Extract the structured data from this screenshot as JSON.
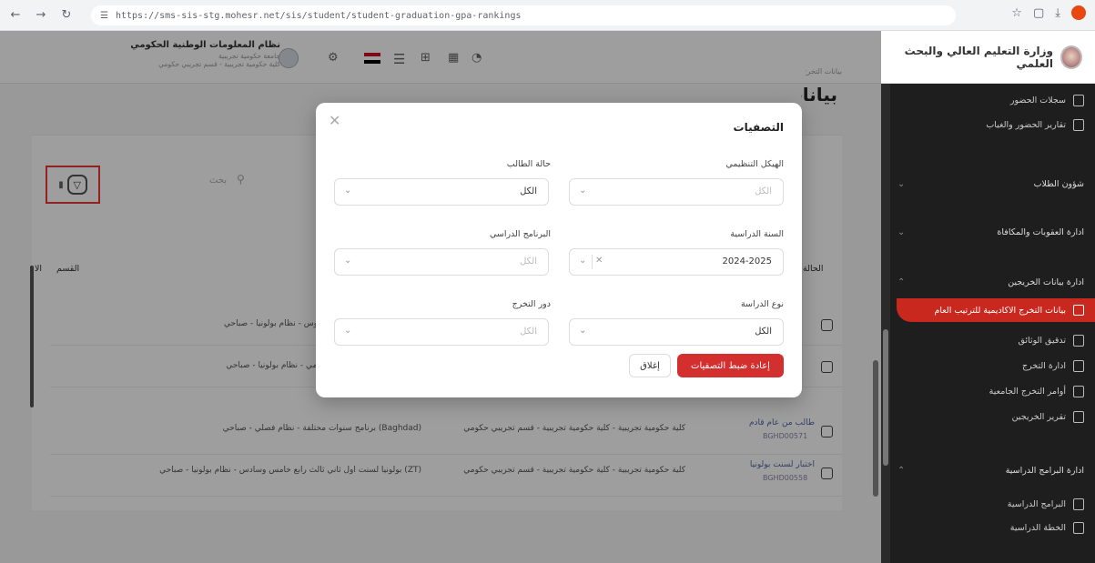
{
  "browser": {
    "url": "https://sms-sis-stg.mohesr.net/sis/student/student-graduation-gpa-rankings",
    "back_icon": "arrow-left-icon",
    "forward_icon": "arrow-right-icon",
    "reload_icon": "reload-icon"
  },
  "sidebar": {
    "ministry_name": "وزارة التعليم العالي والبحث العلمي",
    "items": [
      {
        "label": "سجلات الحضور",
        "type": "item"
      },
      {
        "label": "تقارير الحضور والغياب",
        "type": "item"
      },
      {
        "label": "شؤون الطلاب",
        "type": "group"
      },
      {
        "label": "ادارة العقوبات والمكافاة",
        "type": "group"
      },
      {
        "label": "ادارة بيانات الخريجين",
        "type": "group"
      },
      {
        "label": "بيانات التخرج الاكاديمية للترتيب العام",
        "type": "active"
      },
      {
        "label": "تدقيق الوثائق",
        "type": "item"
      },
      {
        "label": "ادارة التخرج",
        "type": "item"
      },
      {
        "label": "أوامر التخرج الجامعية",
        "type": "item"
      },
      {
        "label": "تقرير الخريجين",
        "type": "item"
      },
      {
        "label": "ادارة البرامج الدراسية",
        "type": "group"
      },
      {
        "label": "البرامج الدراسية",
        "type": "item"
      },
      {
        "label": "الخطة الدراسية",
        "type": "item"
      }
    ]
  },
  "topbar": {
    "uni_name": "نظام المعلومات الوطنية الحكومي",
    "uni_sub1": "جامعة حكومية تجريبية",
    "uni_sub2": "كلية حكومية تجريبية - قسم تجريبي حكومي"
  },
  "page": {
    "breadcrumb": "بيانات التخرج",
    "title": "بيانات",
    "search_placeholder": "بحث",
    "col_section": "القسم",
    "col_index": "الا",
    "col_status": "الحالة",
    "rows": [
      {
        "name": "",
        "id": "",
        "dept": "",
        "program": "برنامج بكالوريوس - نظام بولونيا - صباحي"
      },
      {
        "name": "",
        "id": "",
        "dept": "",
        "program": "بكالوريوس علمي - نظام بولونيا - صباحي"
      },
      {
        "name": "طالب من عام قادم",
        "id": "BGHD00571",
        "dept": "كلية حكومية تجريبية - كلية حكومية تجريبية - قسم تجريبي حكومي",
        "program": "(Baghdad) برنامج سنوات محتلفة - نظام فصلي - صباحي"
      },
      {
        "name": "اختبار لسنت بولونيا",
        "id": "BGHD00558",
        "dept": "كلية حكومية تجريبية - كلية حكومية تجريبية - قسم تجريبي حكومي",
        "program": "(ZT) بولونيا لسنت اول ثاني ثالث رابع خامس وسادس - نظام بولونيا - صباحي"
      }
    ]
  },
  "modal": {
    "title": "التصفيات",
    "close_icon": "close-icon",
    "fields": {
      "org_structure": {
        "label": "الهيكل التنظيمي",
        "value": "الكل",
        "placeholder": true
      },
      "student_status": {
        "label": "حالة الطالب",
        "value": "الكل",
        "placeholder": false
      },
      "academic_year": {
        "label": "السنة الدراسية",
        "value": "2024-2025",
        "placeholder": false
      },
      "study_program": {
        "label": "البرنامج الدراسي",
        "value": "الكل",
        "placeholder": true
      },
      "study_type": {
        "label": "نوع الدراسة",
        "value": "الكل",
        "placeholder": false
      },
      "graduation_round": {
        "label": "دور التخرج",
        "value": "الكل",
        "placeholder": true
      }
    },
    "reset_label": "إعادة ضبط التصفيات",
    "close_label": "إغلاق"
  },
  "colors": {
    "accent_red": "#d32f2f",
    "sidebar_bg": "#1e1e1e"
  }
}
